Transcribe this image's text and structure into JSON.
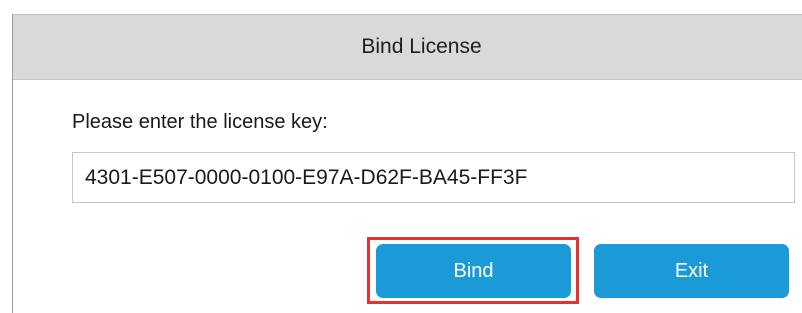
{
  "dialog": {
    "title": "Bind License",
    "prompt": "Please enter the license key:",
    "license_key": "4301-E507-0000-0100-E97A-D62F-BA45-FF3F",
    "bind_label": "Bind",
    "exit_label": "Exit"
  },
  "colors": {
    "title_bar": "#d9d9d9",
    "button": "#1a9bd7",
    "highlight": "#e8312f"
  }
}
